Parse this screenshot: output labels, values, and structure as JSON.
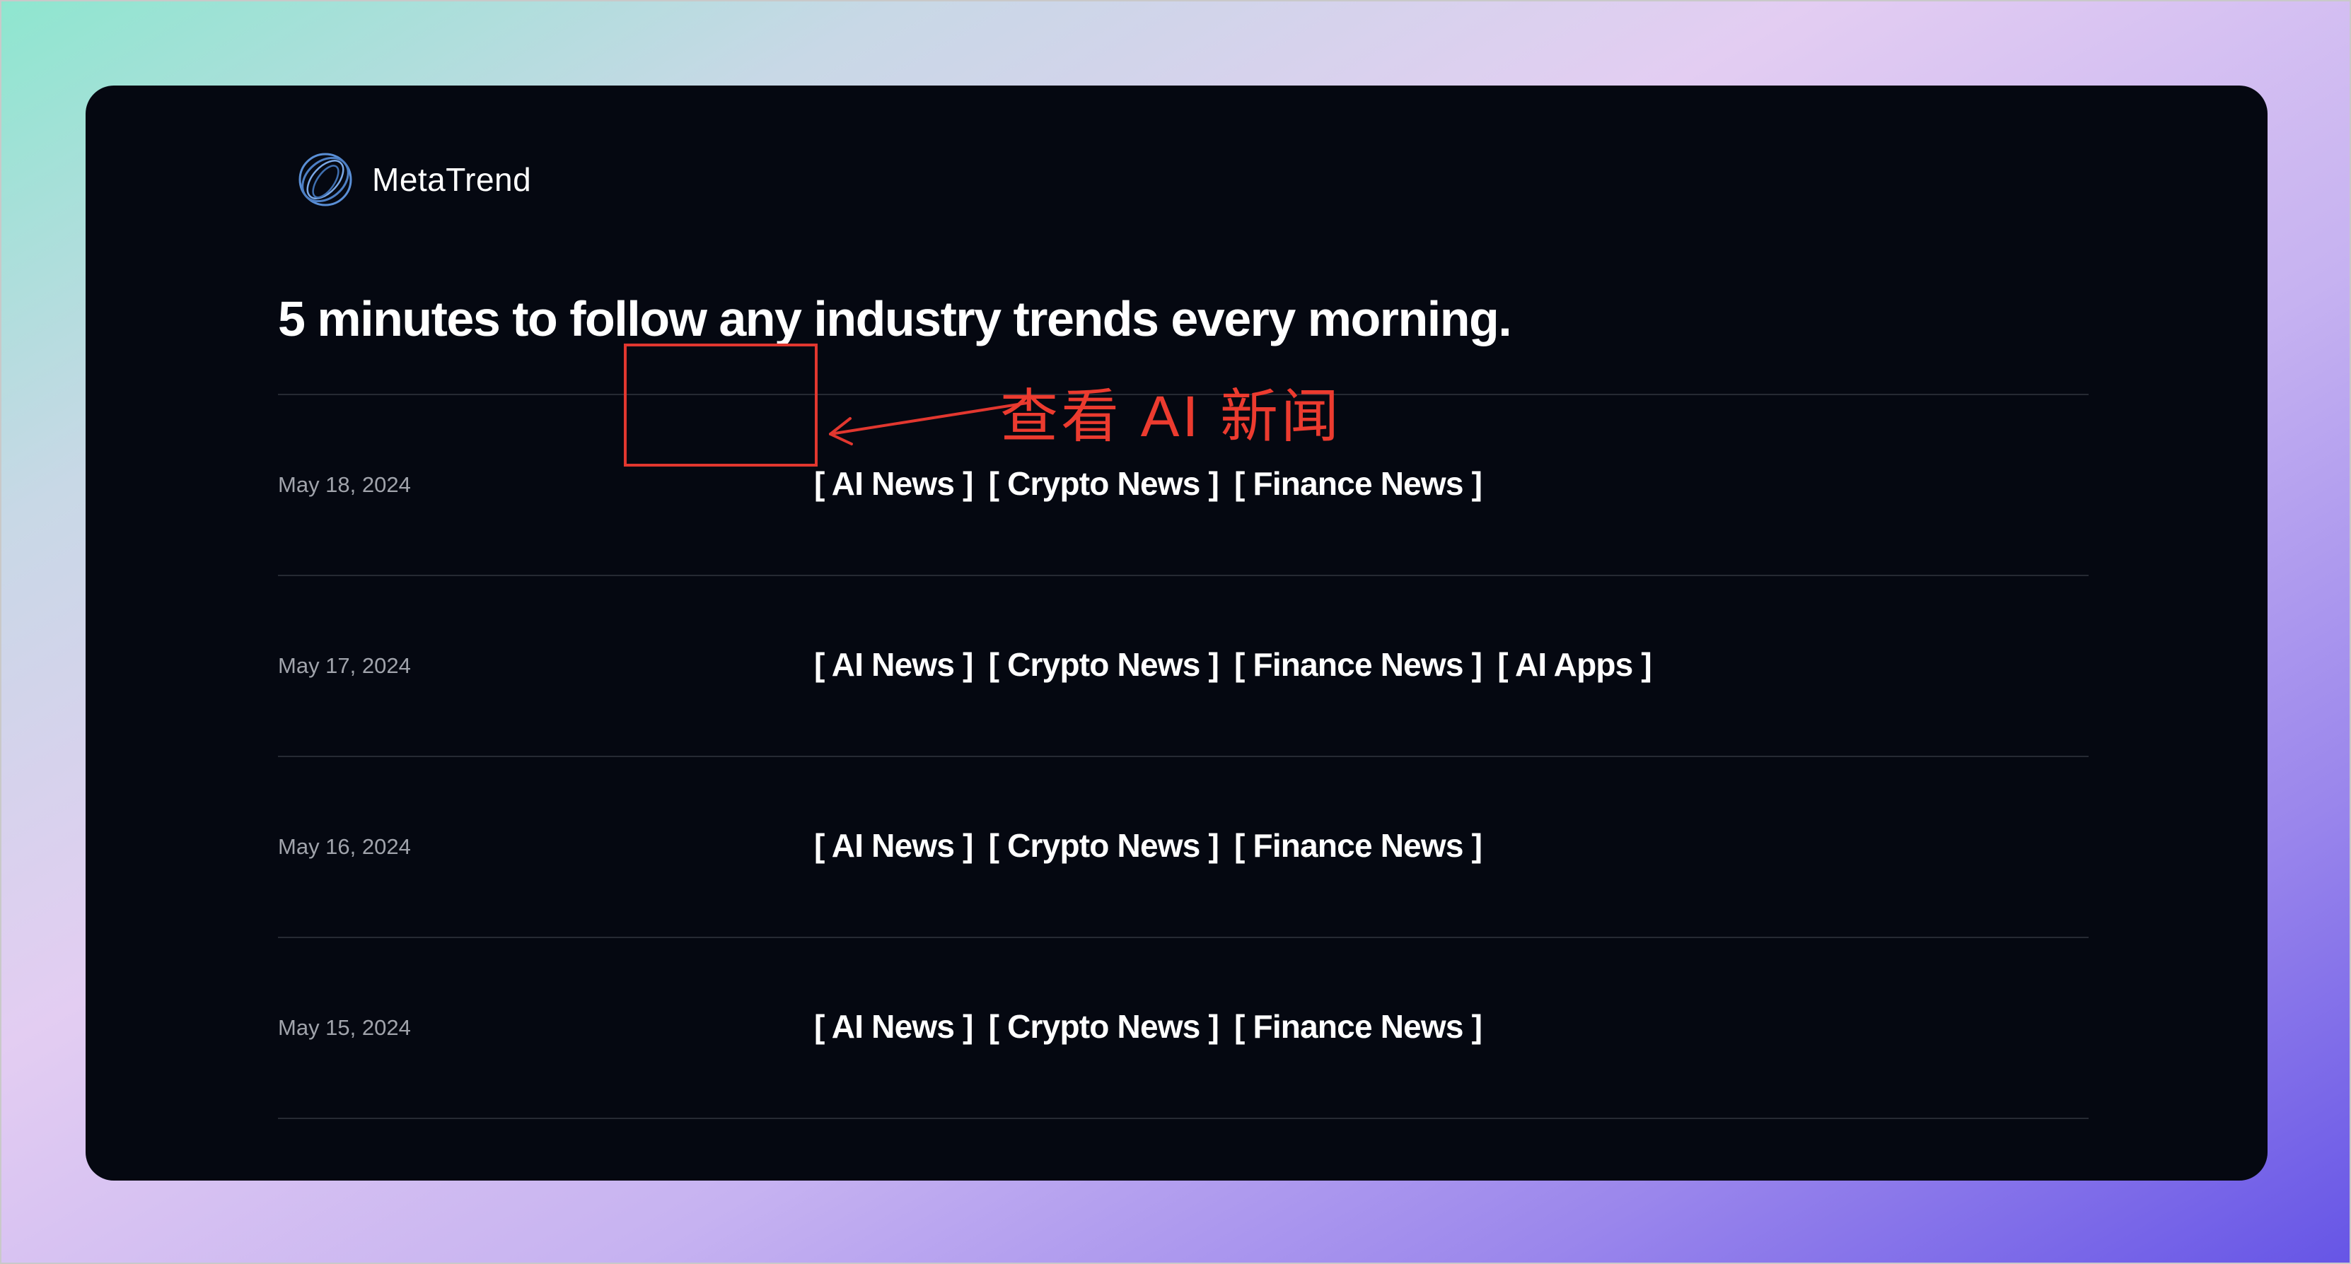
{
  "brand": {
    "name": "MetaTrend",
    "logo_icon": "rings-logo-icon"
  },
  "headline": "5 minutes to follow any industry trends every morning.",
  "entries": [
    {
      "date": "May 18, 2024",
      "tags": [
        "[ AI News ]",
        "[ Crypto News ]",
        "[ Finance News ]"
      ]
    },
    {
      "date": "May 17, 2024",
      "tags": [
        "[ AI News ]",
        "[ Crypto News ]",
        "[ Finance News ]",
        "[ AI Apps ]"
      ]
    },
    {
      "date": "May 16, 2024",
      "tags": [
        "[ AI News ]",
        "[ Crypto News ]",
        "[ Finance News ]"
      ]
    },
    {
      "date": "May 15, 2024",
      "tags": [
        "[ AI News ]",
        "[ Crypto News ]",
        "[ Finance News ]"
      ]
    }
  ],
  "annotation": {
    "text": "查看 AI 新闻",
    "color": "#e2372f"
  },
  "colors": {
    "card_bg": "#050811",
    "divider": "#262a33",
    "date_text": "#a0a3ab",
    "tag_text": "#ffffff",
    "logo_stroke": "#5a8fd6"
  }
}
